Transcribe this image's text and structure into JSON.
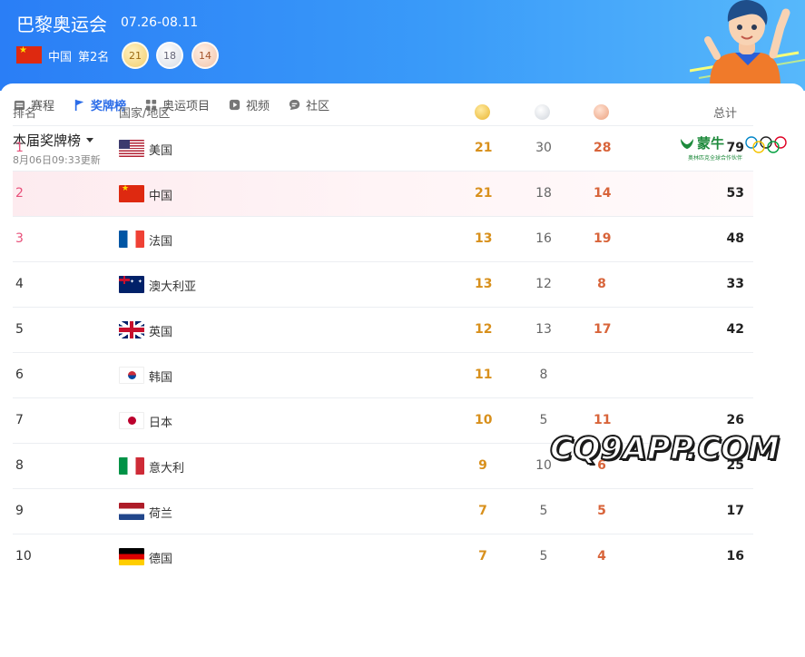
{
  "header": {
    "title": "巴黎奥运会",
    "dates": "07.26-08.11",
    "country": "中国",
    "rank": "第2名",
    "gold": "21",
    "silver": "18",
    "bronze": "14"
  },
  "tabs": [
    {
      "label": "赛程",
      "icon": "calendar-icon"
    },
    {
      "label": "奖牌榜",
      "icon": "flag-icon",
      "active": true
    },
    {
      "label": "奥运项目",
      "icon": "grid-icon"
    },
    {
      "label": "视频",
      "icon": "play-icon"
    },
    {
      "label": "社区",
      "icon": "chat-icon"
    }
  ],
  "board": {
    "title": "本届奖牌榜",
    "update_time": "8月06日09:33更新"
  },
  "sponsor": {
    "name": "蒙牛",
    "tagline": "奥林匹克全球合作伙伴"
  },
  "table": {
    "col_rank": "排名",
    "col_country": "国家/地区",
    "col_total": "总计",
    "rows": [
      {
        "rank": "1",
        "country": "美国",
        "flag": "us",
        "gold": "21",
        "silver": "30",
        "bronze": "28",
        "total": "79"
      },
      {
        "rank": "2",
        "country": "中国",
        "flag": "cn",
        "gold": "21",
        "silver": "18",
        "bronze": "14",
        "total": "53"
      },
      {
        "rank": "3",
        "country": "法国",
        "flag": "fr",
        "gold": "13",
        "silver": "16",
        "bronze": "19",
        "total": "48"
      },
      {
        "rank": "4",
        "country": "澳大利亚",
        "flag": "au",
        "gold": "13",
        "silver": "12",
        "bronze": "8",
        "total": "33"
      },
      {
        "rank": "5",
        "country": "英国",
        "flag": "gb",
        "gold": "12",
        "silver": "13",
        "bronze": "17",
        "total": "42"
      },
      {
        "rank": "6",
        "country": "韩国",
        "flag": "kr",
        "gold": "11",
        "silver": "8",
        "bronze": "",
        "total": ""
      },
      {
        "rank": "7",
        "country": "日本",
        "flag": "jp",
        "gold": "10",
        "silver": "5",
        "bronze": "11",
        "total": "26"
      },
      {
        "rank": "8",
        "country": "意大利",
        "flag": "it",
        "gold": "9",
        "silver": "10",
        "bronze": "6",
        "total": "25"
      },
      {
        "rank": "9",
        "country": "荷兰",
        "flag": "nl",
        "gold": "7",
        "silver": "5",
        "bronze": "5",
        "total": "17"
      },
      {
        "rank": "10",
        "country": "德国",
        "flag": "de",
        "gold": "7",
        "silver": "5",
        "bronze": "4",
        "total": "16"
      }
    ]
  },
  "watermark": "CQ9APP.COM",
  "colors": {
    "accent": "#2b6ce8",
    "gold_text": "#d8901c",
    "bronze_text": "#d8643a",
    "top_rank": "#e8507a"
  }
}
